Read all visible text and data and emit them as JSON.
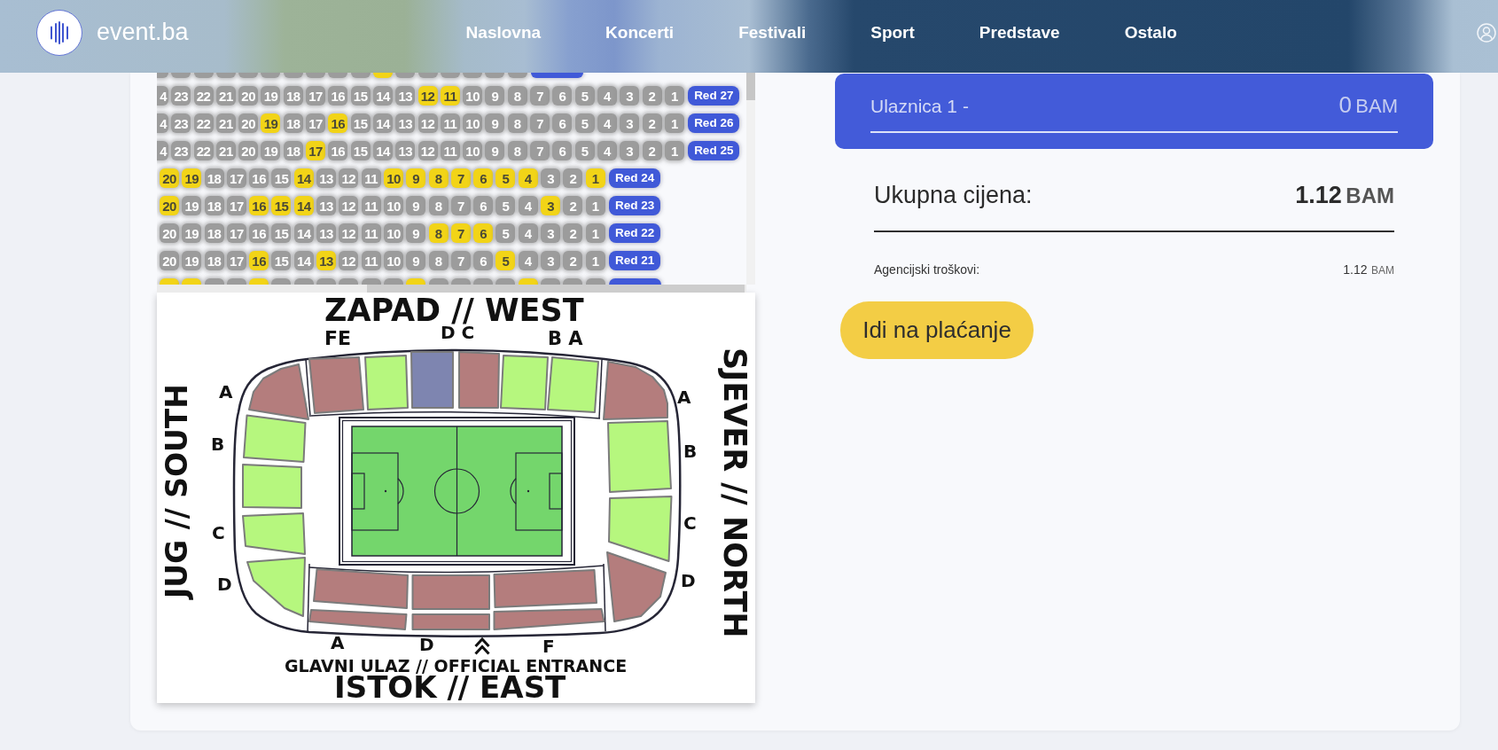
{
  "header": {
    "brand": "event.ba",
    "nav": [
      {
        "label": "Naslovna"
      },
      {
        "label": "Koncerti"
      },
      {
        "label": "Festivali"
      },
      {
        "label": "Sport"
      },
      {
        "label": "Predstave"
      },
      {
        "label": "Ostalo"
      }
    ]
  },
  "seat_map": {
    "rows": [
      {
        "kind": "cut_top",
        "seats": [
          {
            "available": false,
            "cut": true
          },
          {
            "available": false
          },
          {
            "available": false
          },
          {
            "available": false
          },
          {
            "available": false
          },
          {
            "available": false
          },
          {
            "available": false
          },
          {
            "available": false
          },
          {
            "available": false
          },
          {
            "available": false
          },
          {
            "available": true
          },
          {
            "available": false
          },
          {
            "available": false
          },
          {
            "available": false
          },
          {
            "available": false
          },
          {
            "available": false
          },
          {
            "available": false
          }
        ]
      },
      {
        "kind": "full",
        "label": "Red 27",
        "seats": [
          {
            "number": "4",
            "available": false,
            "cut": true
          },
          {
            "number": "23",
            "available": false
          },
          {
            "number": "22",
            "available": false
          },
          {
            "number": "21",
            "available": false
          },
          {
            "number": "20",
            "available": false
          },
          {
            "number": "19",
            "available": false
          },
          {
            "number": "18",
            "available": false
          },
          {
            "number": "17",
            "available": false
          },
          {
            "number": "16",
            "available": false
          },
          {
            "number": "15",
            "available": false
          },
          {
            "number": "14",
            "available": false
          },
          {
            "number": "13",
            "available": false
          },
          {
            "number": "12",
            "available": true
          },
          {
            "number": "11",
            "available": true
          },
          {
            "number": "10",
            "available": false
          },
          {
            "number": "9",
            "available": false
          },
          {
            "number": "8",
            "available": false
          },
          {
            "number": "7",
            "available": false
          },
          {
            "number": "6",
            "available": false
          },
          {
            "number": "5",
            "available": false
          },
          {
            "number": "4",
            "available": false
          },
          {
            "number": "3",
            "available": false
          },
          {
            "number": "2",
            "available": false
          },
          {
            "number": "1",
            "available": false
          }
        ]
      },
      {
        "kind": "full",
        "label": "Red 26",
        "seats": [
          {
            "number": "4",
            "available": false,
            "cut": true
          },
          {
            "number": "23",
            "available": false
          },
          {
            "number": "22",
            "available": false
          },
          {
            "number": "21",
            "available": false
          },
          {
            "number": "20",
            "available": false
          },
          {
            "number": "19",
            "available": true
          },
          {
            "number": "18",
            "available": false
          },
          {
            "number": "17",
            "available": false
          },
          {
            "number": "16",
            "available": true
          },
          {
            "number": "15",
            "available": false
          },
          {
            "number": "14",
            "available": false
          },
          {
            "number": "13",
            "available": false
          },
          {
            "number": "12",
            "available": false
          },
          {
            "number": "11",
            "available": false
          },
          {
            "number": "10",
            "available": false
          },
          {
            "number": "9",
            "available": false
          },
          {
            "number": "8",
            "available": false
          },
          {
            "number": "7",
            "available": false
          },
          {
            "number": "6",
            "available": false
          },
          {
            "number": "5",
            "available": false
          },
          {
            "number": "4",
            "available": false
          },
          {
            "number": "3",
            "available": false
          },
          {
            "number": "2",
            "available": false
          },
          {
            "number": "1",
            "available": false
          }
        ]
      },
      {
        "kind": "full",
        "label": "Red 25",
        "seats": [
          {
            "number": "4",
            "available": false,
            "cut": true
          },
          {
            "number": "23",
            "available": false
          },
          {
            "number": "22",
            "available": false
          },
          {
            "number": "21",
            "available": false
          },
          {
            "number": "20",
            "available": false
          },
          {
            "number": "19",
            "available": false
          },
          {
            "number": "18",
            "available": false
          },
          {
            "number": "17",
            "available": true
          },
          {
            "number": "16",
            "available": false
          },
          {
            "number": "15",
            "available": false
          },
          {
            "number": "14",
            "available": false
          },
          {
            "number": "13",
            "available": false
          },
          {
            "number": "12",
            "available": false
          },
          {
            "number": "11",
            "available": false
          },
          {
            "number": "10",
            "available": false
          },
          {
            "number": "9",
            "available": false
          },
          {
            "number": "8",
            "available": false
          },
          {
            "number": "7",
            "available": false
          },
          {
            "number": "6",
            "available": false
          },
          {
            "number": "5",
            "available": false
          },
          {
            "number": "4",
            "available": false
          },
          {
            "number": "3",
            "available": false
          },
          {
            "number": "2",
            "available": false
          },
          {
            "number": "1",
            "available": false
          }
        ]
      },
      {
        "kind": "full",
        "label": "Red 24",
        "seats": [
          {
            "number": "20",
            "available": true
          },
          {
            "number": "19",
            "available": true
          },
          {
            "number": "18",
            "available": false
          },
          {
            "number": "17",
            "available": false
          },
          {
            "number": "16",
            "available": false
          },
          {
            "number": "15",
            "available": false
          },
          {
            "number": "14",
            "available": true
          },
          {
            "number": "13",
            "available": false
          },
          {
            "number": "12",
            "available": false
          },
          {
            "number": "11",
            "available": false
          },
          {
            "number": "10",
            "available": true
          },
          {
            "number": "9",
            "available": true
          },
          {
            "number": "8",
            "available": true
          },
          {
            "number": "7",
            "available": true
          },
          {
            "number": "6",
            "available": true
          },
          {
            "number": "5",
            "available": true
          },
          {
            "number": "4",
            "available": true
          },
          {
            "number": "3",
            "available": false
          },
          {
            "number": "2",
            "available": false
          },
          {
            "number": "1",
            "available": true
          }
        ]
      },
      {
        "kind": "full",
        "label": "Red 23",
        "seats": [
          {
            "number": "20",
            "available": true
          },
          {
            "number": "19",
            "available": false
          },
          {
            "number": "18",
            "available": false
          },
          {
            "number": "17",
            "available": false
          },
          {
            "number": "16",
            "available": true
          },
          {
            "number": "15",
            "available": true
          },
          {
            "number": "14",
            "available": true
          },
          {
            "number": "13",
            "available": false
          },
          {
            "number": "12",
            "available": false
          },
          {
            "number": "11",
            "available": false
          },
          {
            "number": "10",
            "available": false
          },
          {
            "number": "9",
            "available": false
          },
          {
            "number": "8",
            "available": false
          },
          {
            "number": "7",
            "available": false
          },
          {
            "number": "6",
            "available": false
          },
          {
            "number": "5",
            "available": false
          },
          {
            "number": "4",
            "available": false
          },
          {
            "number": "3",
            "available": true
          },
          {
            "number": "2",
            "available": false
          },
          {
            "number": "1",
            "available": false
          }
        ]
      },
      {
        "kind": "full",
        "label": "Red 22",
        "seats": [
          {
            "number": "20",
            "available": false
          },
          {
            "number": "19",
            "available": false
          },
          {
            "number": "18",
            "available": false
          },
          {
            "number": "17",
            "available": false
          },
          {
            "number": "16",
            "available": false
          },
          {
            "number": "15",
            "available": false
          },
          {
            "number": "14",
            "available": false
          },
          {
            "number": "13",
            "available": false
          },
          {
            "number": "12",
            "available": false
          },
          {
            "number": "11",
            "available": false
          },
          {
            "number": "10",
            "available": false
          },
          {
            "number": "9",
            "available": false
          },
          {
            "number": "8",
            "available": true
          },
          {
            "number": "7",
            "available": true
          },
          {
            "number": "6",
            "available": true
          },
          {
            "number": "5",
            "available": false
          },
          {
            "number": "4",
            "available": false
          },
          {
            "number": "3",
            "available": false
          },
          {
            "number": "2",
            "available": false
          },
          {
            "number": "1",
            "available": false
          }
        ]
      },
      {
        "kind": "full",
        "label": "Red 21",
        "seats": [
          {
            "number": "20",
            "available": false
          },
          {
            "number": "19",
            "available": false
          },
          {
            "number": "18",
            "available": false
          },
          {
            "number": "17",
            "available": false
          },
          {
            "number": "16",
            "available": true
          },
          {
            "number": "15",
            "available": false
          },
          {
            "number": "14",
            "available": false
          },
          {
            "number": "13",
            "available": true
          },
          {
            "number": "12",
            "available": false
          },
          {
            "number": "11",
            "available": false
          },
          {
            "number": "10",
            "available": false
          },
          {
            "number": "9",
            "available": false
          },
          {
            "number": "8",
            "available": false
          },
          {
            "number": "7",
            "available": false
          },
          {
            "number": "6",
            "available": false
          },
          {
            "number": "5",
            "available": true
          },
          {
            "number": "4",
            "available": false
          },
          {
            "number": "3",
            "available": false
          },
          {
            "number": "2",
            "available": false
          },
          {
            "number": "1",
            "available": false
          }
        ]
      },
      {
        "kind": "cut_bottom",
        "seats": [
          {
            "available": true
          },
          {
            "available": true
          },
          {
            "available": false
          },
          {
            "available": false
          },
          {
            "available": true
          },
          {
            "available": false
          },
          {
            "available": false
          },
          {
            "available": false
          },
          {
            "available": false
          },
          {
            "available": false
          },
          {
            "available": false
          },
          {
            "available": true
          },
          {
            "available": false
          },
          {
            "available": false
          },
          {
            "available": false
          },
          {
            "available": false
          },
          {
            "available": true
          },
          {
            "available": false
          },
          {
            "available": false
          },
          {
            "available": false
          }
        ]
      }
    ]
  },
  "stadium_map": {
    "sides": [
      {
        "kind": "west",
        "title": "ZAPAD // WEST",
        "letters": [
          "FE",
          "D C",
          "B A"
        ],
        "sections": [
          {
            "color": "#b47d7d"
          },
          {
            "color": "#b6f77e"
          },
          {
            "color": "#7e85b0"
          },
          {
            "color": "#b47d7d"
          },
          {
            "color": "#b6f77e"
          },
          {
            "color": "#b6f77e"
          }
        ]
      },
      {
        "kind": "south",
        "title": "JUG // SOUTH",
        "letters": [
          "A",
          "B",
          "C",
          "D"
        ],
        "sections": [
          {
            "color": "#b47d7d"
          },
          {
            "color": "#b6f77e"
          },
          {
            "color": "#b6f77e"
          },
          {
            "color": "#b6f77e"
          },
          {
            "color": "#b6f77e"
          }
        ]
      },
      {
        "kind": "north",
        "title": "SJEVER // NORTH",
        "letters": [
          "A",
          "B",
          "C",
          "D"
        ],
        "sections": [
          {
            "color": "#b47d7d"
          },
          {
            "color": "#b6f77e"
          },
          {
            "color": "#b6f77e"
          },
          {
            "color": "#b47d7d"
          }
        ]
      },
      {
        "kind": "east",
        "title": "ISTOK // EAST",
        "letters": [
          "A",
          "D",
          "F"
        ],
        "entrance": "GLAVNI ULAZ // OFFICIAL ENTRANCE",
        "sections": [
          {
            "color": "#b47d7d"
          },
          {
            "color": "#b47d7d"
          },
          {
            "color": "#b47d7d"
          },
          {
            "color": "#b47d7d"
          },
          {
            "color": "#b47d7d"
          },
          {
            "color": "#b47d7d"
          }
        ]
      }
    ]
  },
  "ticket": {
    "label": "Ulaznica 1 -",
    "amount": "0",
    "currency": "BAM"
  },
  "summary": {
    "total_label": "Ukupna cijena:",
    "total_amount": "1.12",
    "total_currency": "BAM",
    "fee_label": "Agencijski troškovi:",
    "fee_amount": "1.12",
    "fee_currency": "BAM"
  },
  "pay_button": "Idi na plaćanje"
}
